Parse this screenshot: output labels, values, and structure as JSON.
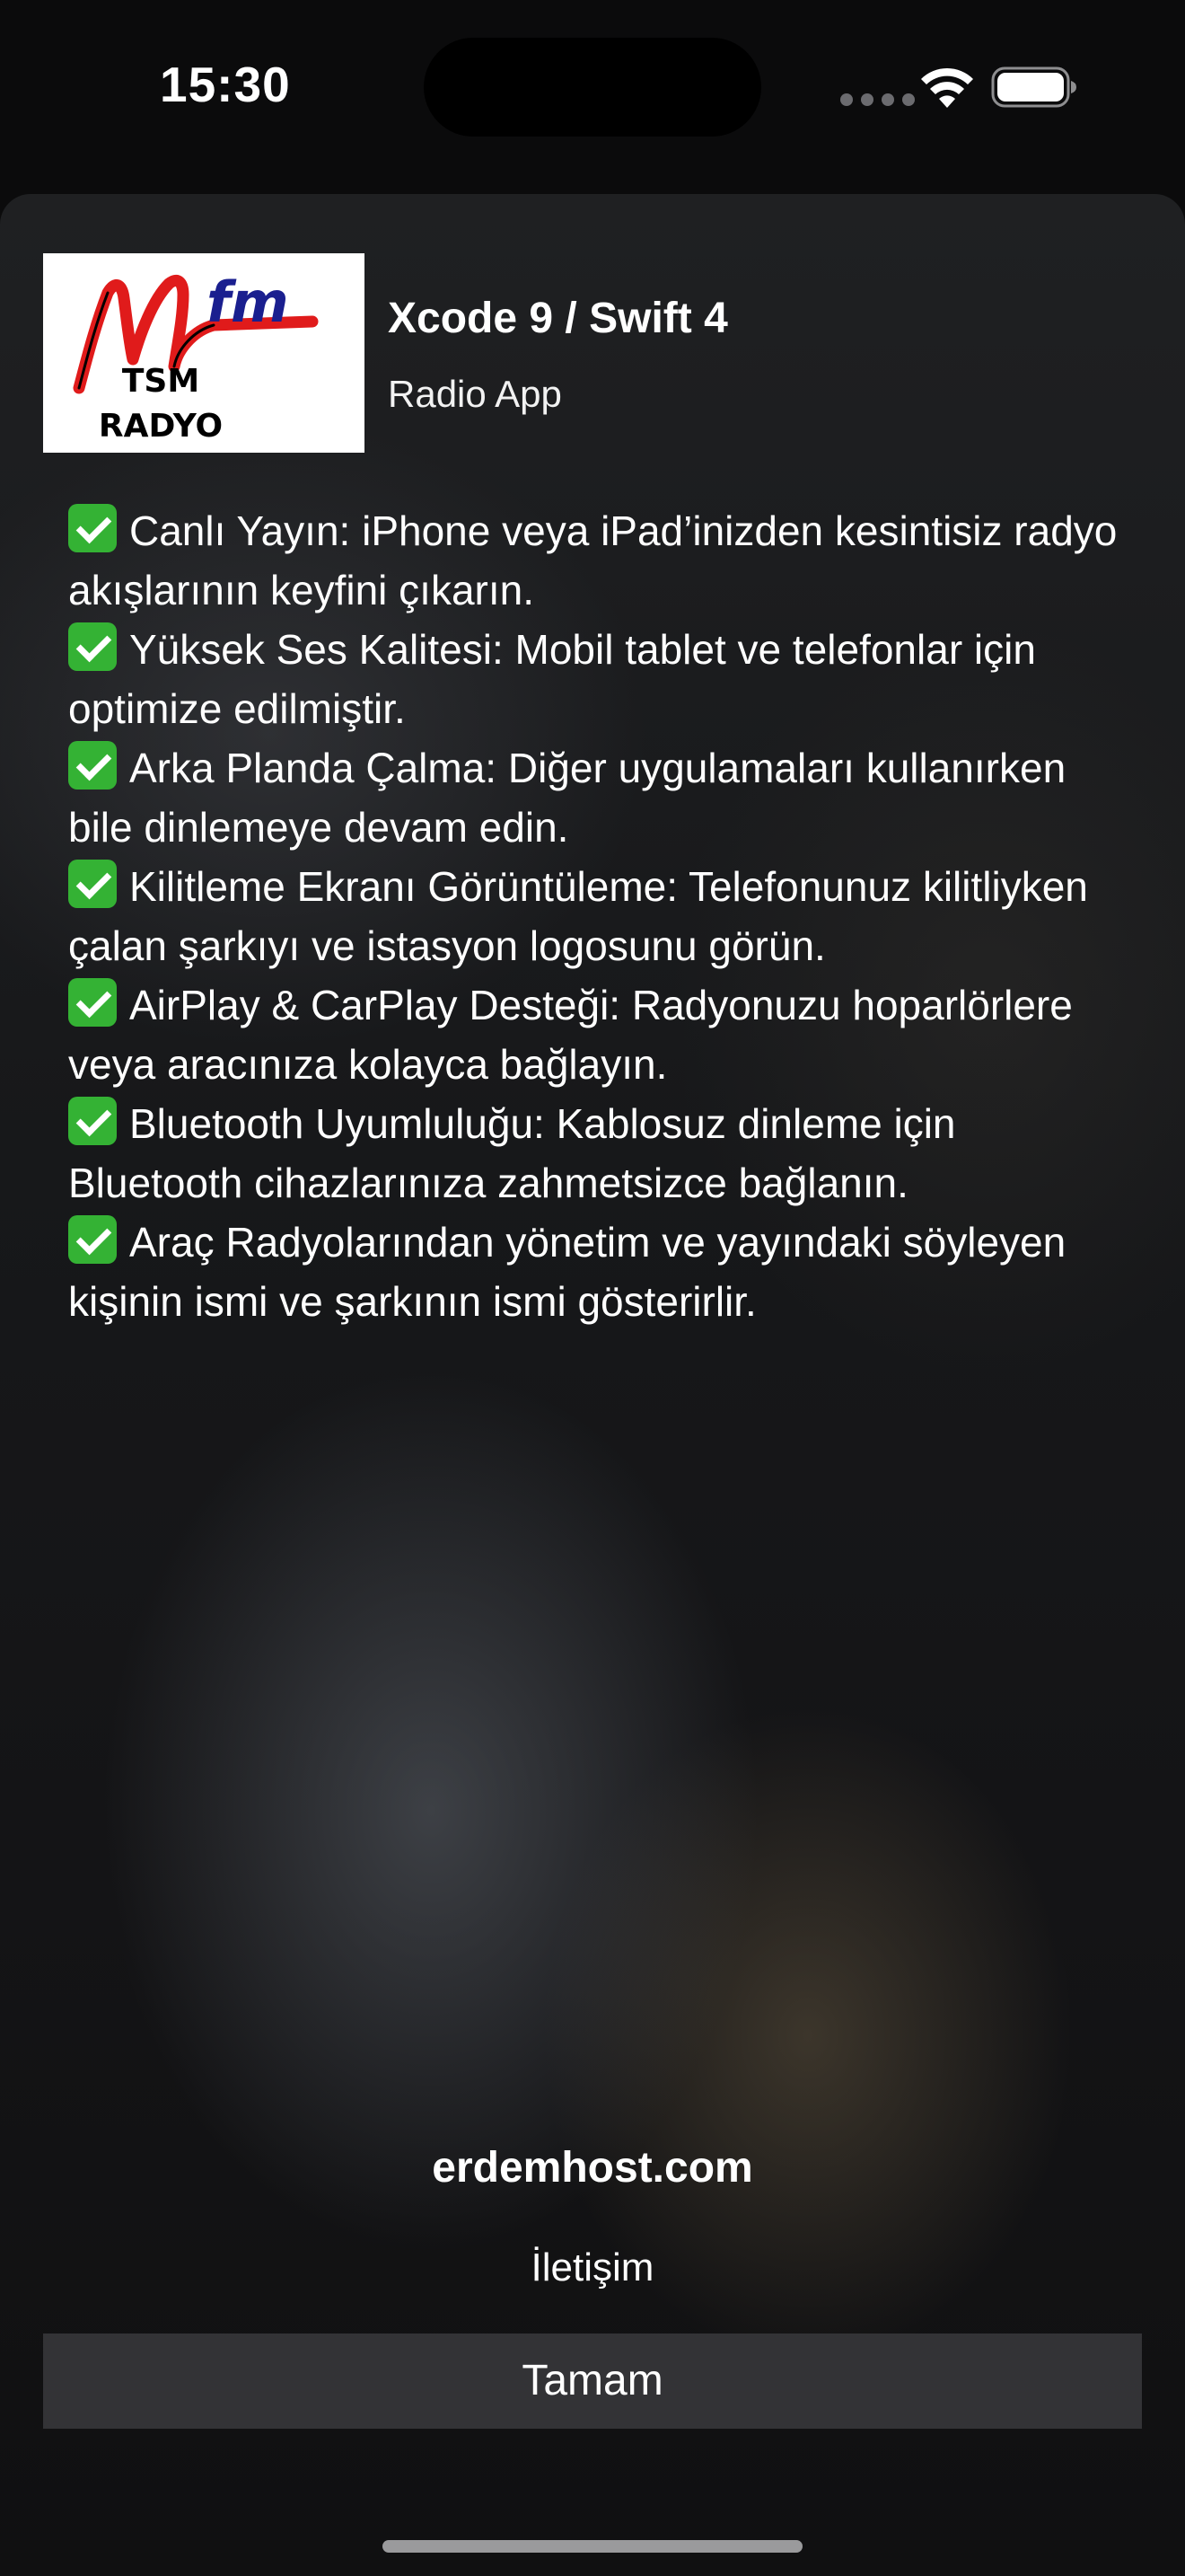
{
  "status_bar": {
    "time": "15:30",
    "icons": [
      "cellular-dots-icon",
      "wifi-icon",
      "battery-icon"
    ]
  },
  "header": {
    "logo": {
      "mark": "M",
      "fm": "fm",
      "line1": "TSM",
      "line2": "RADYO"
    },
    "title": "Xcode 9 / Swift 4",
    "subtitle": "Radio App"
  },
  "features": [
    "Canlı Yayın: iPhone veya iPad’inizden kesintisiz radyo akışlarının keyfini çıkarın.",
    "Yüksek Ses Kalitesi: Mobil tablet ve telefonlar için optimize edilmiştir.",
    "Arka Planda Çalma: Diğer uygulamaları kullanırken bile dinlemeye devam edin.",
    "Kilitleme Ekranı Görüntüleme: Telefonunuz kilitliyken çalan şarkıyı ve istasyon logosunu görün.",
    "AirPlay & CarPlay Desteği: Radyonuzu hoparlörlere veya aracınıza kolayca bağlayın.",
    "Bluetooth Uyumluluğu: Kablosuz dinleme için Bluetooth cihazlarınıza zahmetsizce bağlanın.",
    "Araç Radyolarından yönetim ve yayındaki söyleyen kişinin ismi ve şarkının ismi gösterirlir."
  ],
  "footer": {
    "host": "erdemhost.com",
    "contact": "İletişim",
    "ok_label": "Tamam"
  },
  "colors": {
    "check_green": "#34b234",
    "logo_red": "#e01b1b",
    "logo_blue": "#1a1f8f",
    "button_bg": "#333336"
  }
}
